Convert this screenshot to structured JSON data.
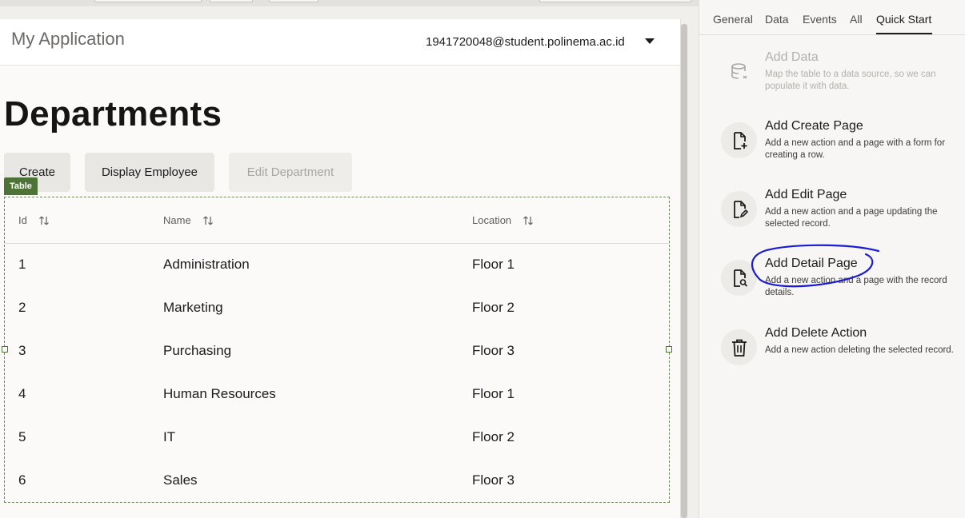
{
  "app": {
    "title": "My Application",
    "user": "1941720048@student.polinema.ac.id"
  },
  "page": {
    "heading": "Departments"
  },
  "toolbar": {
    "create": "Create",
    "display_employee": "Display Employee",
    "edit_department": "Edit Department"
  },
  "table": {
    "tag": "Table",
    "columns": [
      "Id",
      "Name",
      "Location"
    ],
    "rows": [
      [
        "1",
        "Administration",
        "Floor 1"
      ],
      [
        "2",
        "Marketing",
        "Floor 2"
      ],
      [
        "3",
        "Purchasing",
        "Floor 3"
      ],
      [
        "4",
        "Human Resources",
        "Floor 1"
      ],
      [
        "5",
        "IT",
        "Floor 2"
      ],
      [
        "6",
        "Sales",
        "Floor 3"
      ]
    ]
  },
  "panel": {
    "tabs": [
      "General",
      "Data",
      "Events",
      "All",
      "Quick Start"
    ],
    "active_tab": "Quick Start",
    "actions": [
      {
        "title": "Add Data",
        "desc": "Map the table to a data source, so we can populate it with data.",
        "icon": "database-icon",
        "enabled": false
      },
      {
        "title": "Add Create Page",
        "desc": "Add a new action and a page with a form for creating a row.",
        "icon": "file-plus-icon",
        "enabled": true
      },
      {
        "title": "Add Edit Page",
        "desc": "Add a new action and a page updating the selected record.",
        "icon": "file-edit-icon",
        "enabled": true
      },
      {
        "title": "Add Detail Page",
        "desc": "Add a new action and a page with the record details.",
        "icon": "file-search-icon",
        "enabled": true
      },
      {
        "title": "Add Delete Action",
        "desc": "Add a new action deleting the selected record.",
        "icon": "trash-icon",
        "enabled": true
      }
    ]
  },
  "colors": {
    "table_accent": "#4d7436",
    "annotation": "#1a1ad6"
  }
}
